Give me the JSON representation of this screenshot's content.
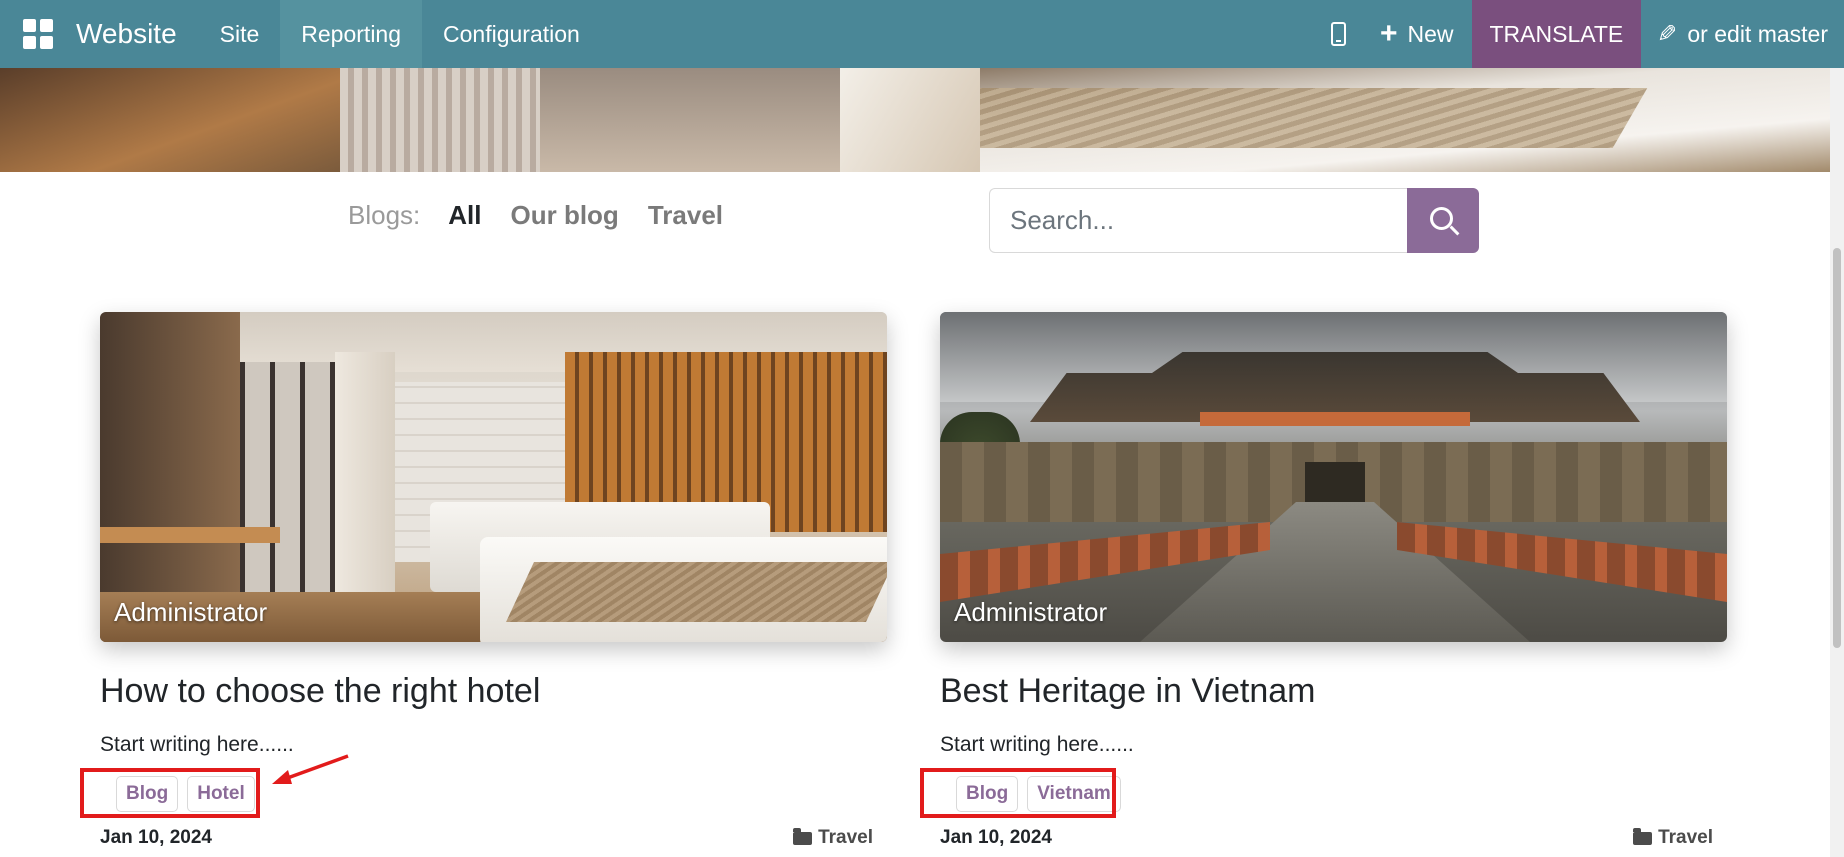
{
  "navbar": {
    "brand": "Website",
    "menu": [
      "Site",
      "Reporting",
      "Configuration"
    ],
    "active_menu": "Reporting",
    "new_label": "New",
    "translate_label": "TRANSLATE",
    "edit_label": "or edit master",
    "color": "#4a8797",
    "translate_color": "#7a4f7e"
  },
  "filter": {
    "label": "Blogs:",
    "links": [
      "All",
      "Our blog",
      "Travel"
    ],
    "active": "All"
  },
  "search": {
    "placeholder": "Search...",
    "button_color": "#8b6b98"
  },
  "posts": [
    {
      "author": "Administrator",
      "title": "How to choose the right hotel",
      "teaser": "Start writing here......",
      "tags": [
        "Blog",
        "Hotel"
      ],
      "date": "Jan 10, 2024",
      "category": "Travel"
    },
    {
      "author": "Administrator",
      "title": "Best Heritage in Vietnam",
      "teaser": "Start writing here......",
      "tags": [
        "Blog",
        "Vietnam"
      ],
      "date": "Jan 10, 2024",
      "category": "Travel"
    }
  ],
  "annotation_color": "#e21b1b"
}
